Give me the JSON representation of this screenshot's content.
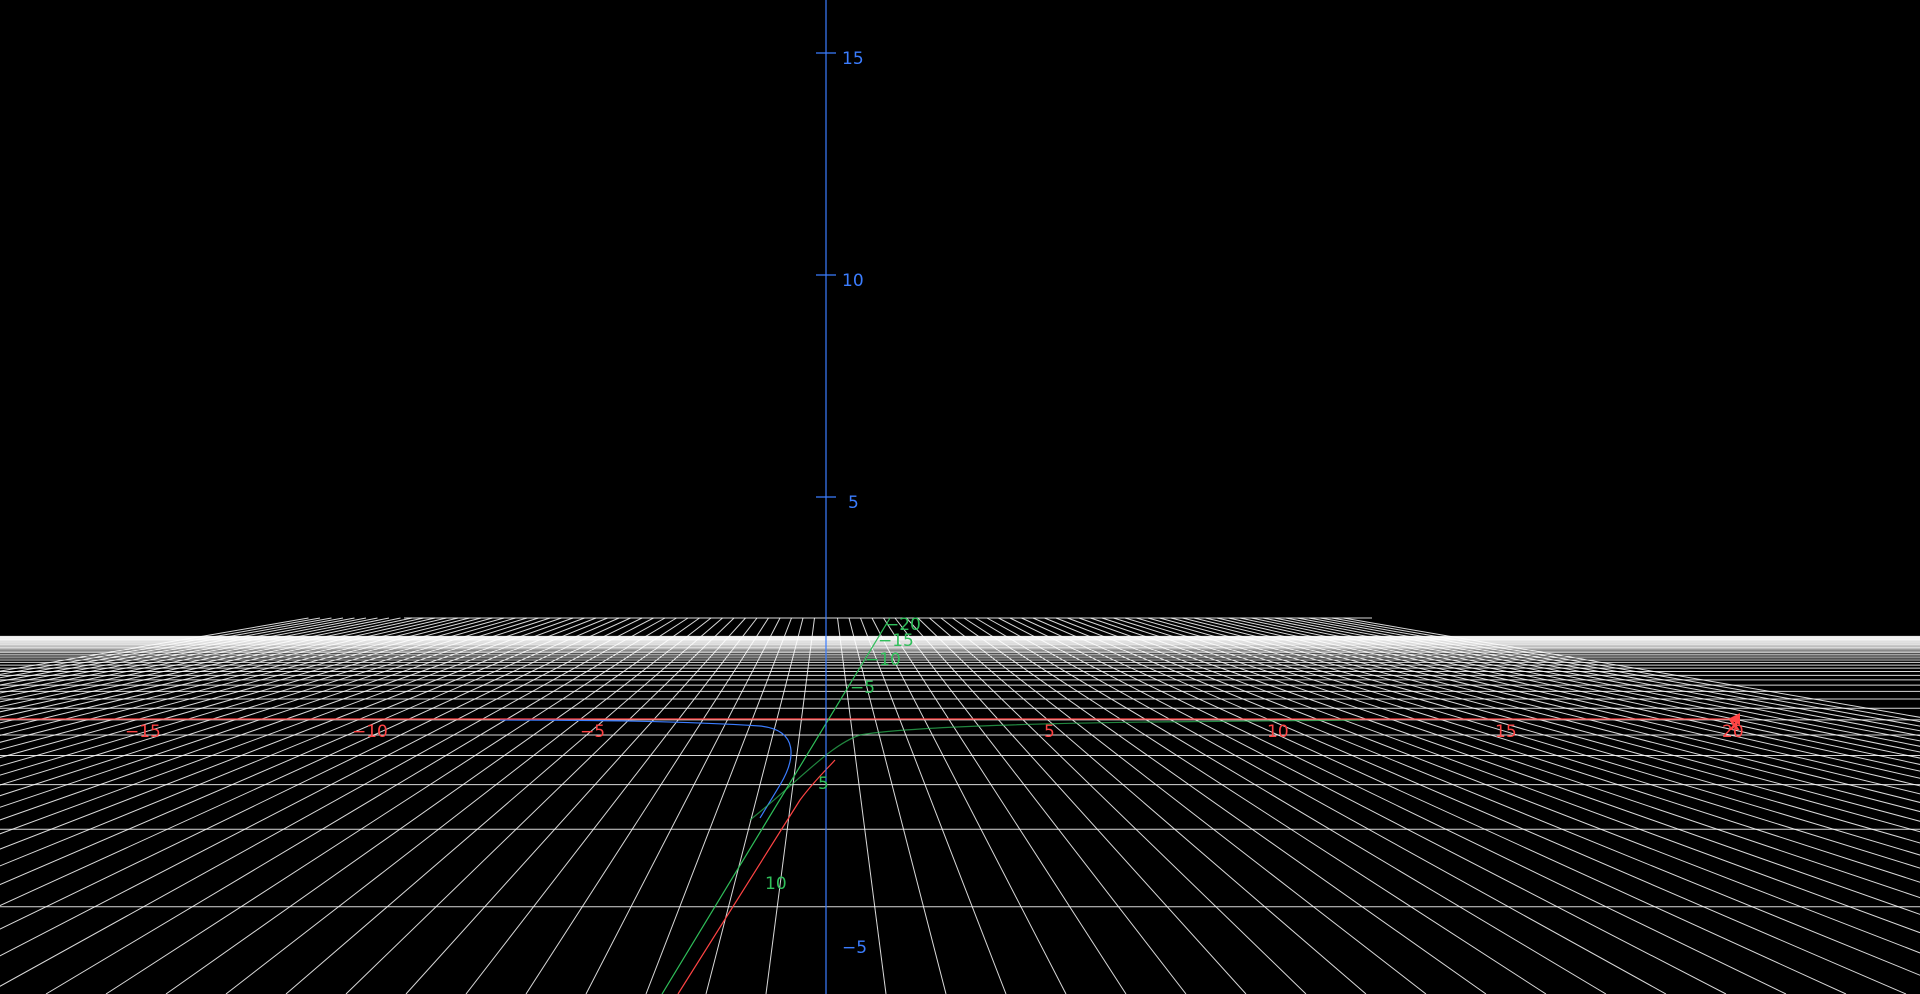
{
  "colors": {
    "background": "#000000",
    "grid": "#ffffff",
    "x_axis": "#ff4444",
    "y_axis": "#2fbf5a",
    "z_axis": "#3b7dff"
  },
  "axes": {
    "x_ticks": [
      "−15",
      "−10",
      "−5",
      "5",
      "10",
      "15",
      "20"
    ],
    "x_label": "x",
    "y_ticks": [
      "−20",
      "−15",
      "−10",
      "−5",
      "5",
      "10"
    ],
    "z_ticks": [
      "15",
      "10",
      "5",
      "−5"
    ]
  },
  "icons": {
    "x_axis_arrow": "arrowhead-icon"
  }
}
